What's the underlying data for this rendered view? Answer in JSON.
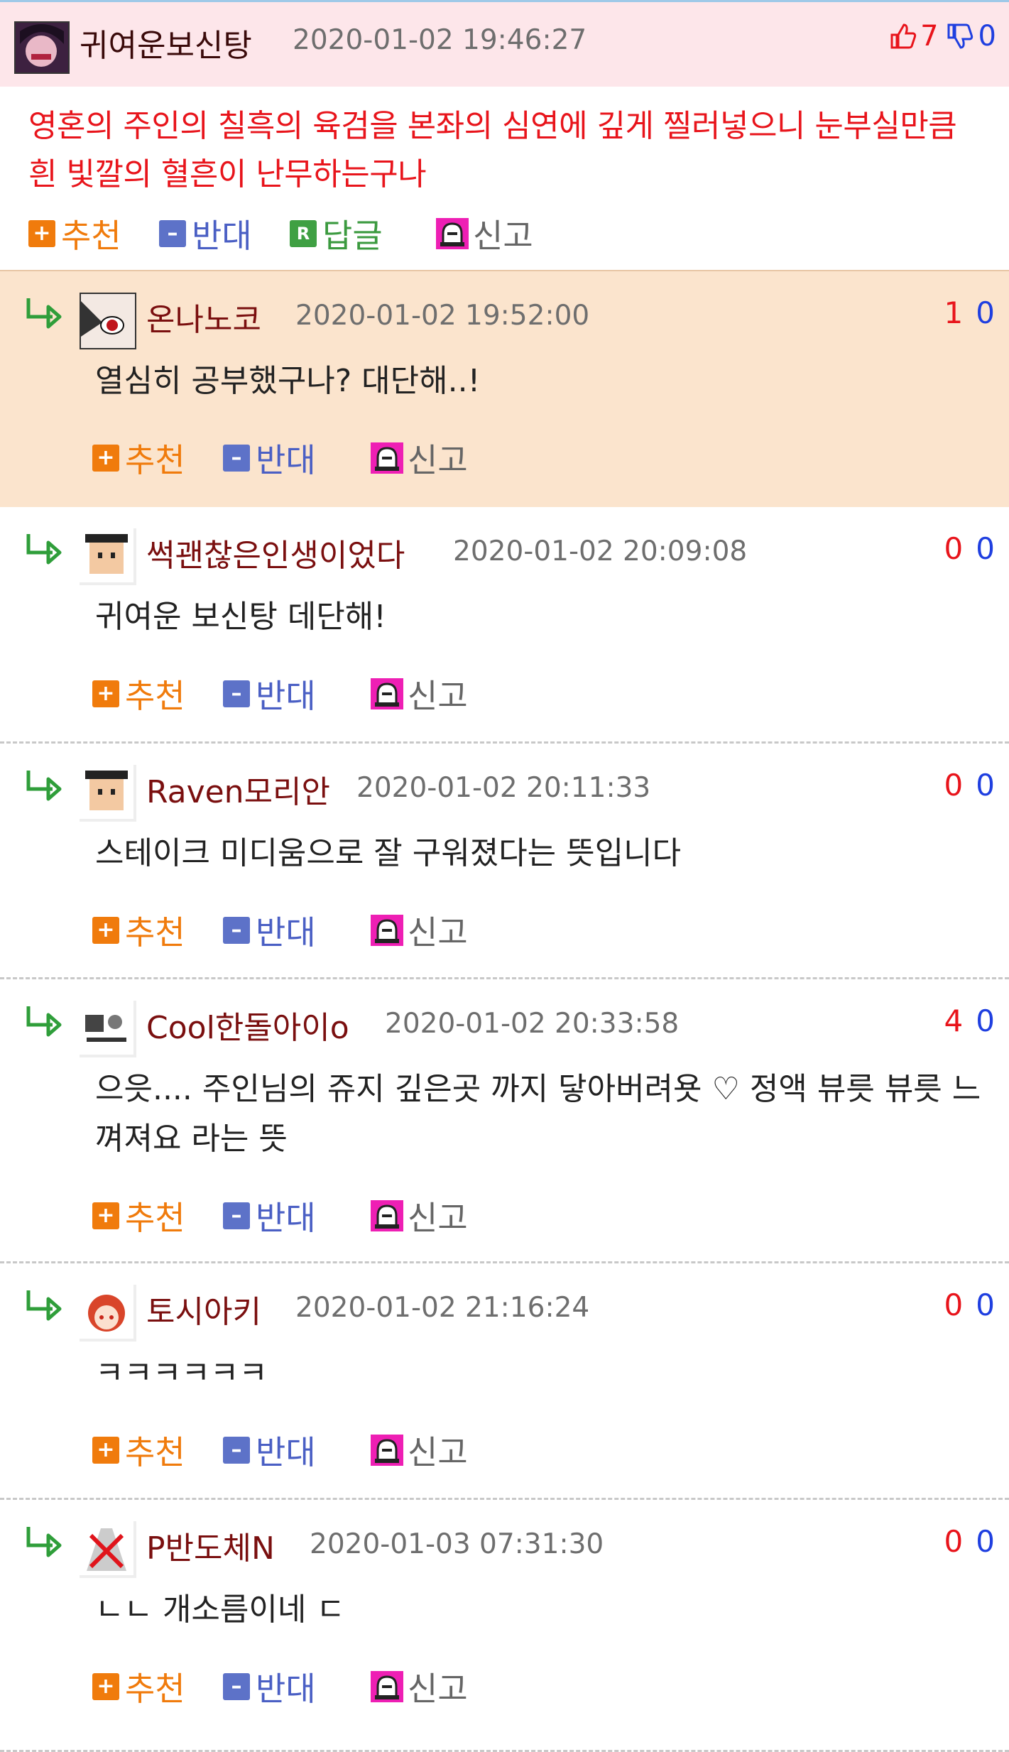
{
  "post": {
    "nickname": "귀여운보신탕",
    "date": "2020-01-02 19:46:27",
    "likes": "7",
    "dislikes": "0",
    "text": "영혼의 주인의 칠흑의 육검을 본좌의 심연에 깊게 찔러넣으니 눈부실만큼 흰 빛깔의 혈흔이 난무하는구나",
    "actions": {
      "recommend": "추천",
      "oppose": "반대",
      "reply": "답글",
      "report": "신고",
      "reply_badge": "R"
    }
  },
  "comment_actions": {
    "recommend": "추천",
    "oppose": "반대",
    "report": "신고"
  },
  "comments": [
    {
      "nickname": "온나노코",
      "date": "2020-01-02 19:52:00",
      "up": "1",
      "down": "0",
      "text": "열심히 공부했구나? 대단해..!"
    },
    {
      "nickname": "썩괜찮은인생이었다",
      "date": "2020-01-02 20:09:08",
      "up": "0",
      "down": "0",
      "text": "귀여운 보신탕 데단해!"
    },
    {
      "nickname": "Raven모리안",
      "date": "2020-01-02 20:11:33",
      "up": "0",
      "down": "0",
      "text": "스테이크 미디움으로 잘 구워졌다는 뜻입니다"
    },
    {
      "nickname": "Cool한돌아이o",
      "date": "2020-01-02 20:33:58",
      "up": "4",
      "down": "0",
      "text": "으읏.... 주인님의 쥬지 깊은곳 까지 닿아버려욧 ♡ 정액 뷰릇 뷰릇 느껴져요 라는 뜻"
    },
    {
      "nickname": "토시아키",
      "date": "2020-01-02 21:16:24",
      "up": "0",
      "down": "0",
      "text": "ㅋㅋㅋㅋㅋㅋ"
    },
    {
      "nickname": "P반도체N",
      "date": "2020-01-03 07:31:30",
      "up": "0",
      "down": "0",
      "text": "ㄴㄴ 개소름이네 ㄷ"
    }
  ],
  "colors": {
    "post_header_bg": "#fde6ea",
    "highlight_bg": "#fbe4cd",
    "post_text": "#e8141b",
    "nick": "#7a0f0f",
    "recommend": "#f07b0c",
    "oppose": "#4a5fc4",
    "reply": "#3b9a3f",
    "up_count": "#e8141b",
    "down_count": "#1f3fe0"
  },
  "icons": {
    "like": "thumbs-up-icon",
    "dislike": "thumbs-down-icon",
    "reply_arrow": "reply-arrow-icon",
    "report": "siren-icon"
  }
}
